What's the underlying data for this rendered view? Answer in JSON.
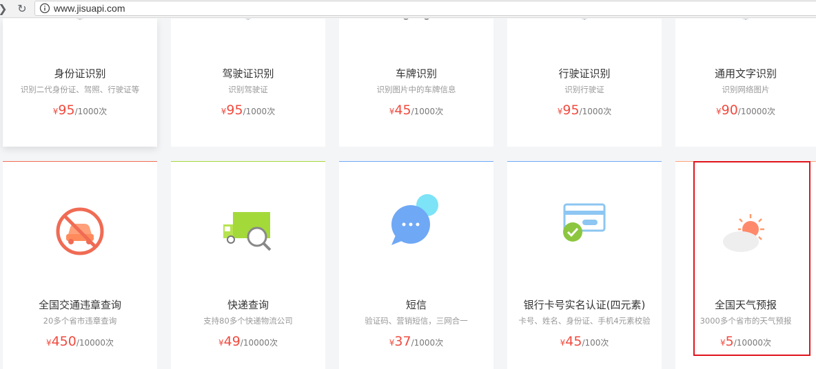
{
  "browser": {
    "url": "www.jisuapi.com"
  },
  "cards": [
    {
      "title": "身份证识别",
      "desc": "识别二代身份证、驾照、行驶证等",
      "currency": "¥",
      "price": "95",
      "unit": "/1000次",
      "icon": "id-card-scan-icon"
    },
    {
      "title": "驾驶证识别",
      "desc": "识别驾驶证",
      "currency": "¥",
      "price": "95",
      "unit": "/1000次",
      "icon": "driver-license-scan-icon"
    },
    {
      "title": "车牌识别",
      "desc": "识别图片中的车牌信息",
      "currency": "¥",
      "price": "45",
      "unit": "/1000次",
      "icon": "license-plate-car-icon"
    },
    {
      "title": "行驶证识别",
      "desc": "识别行驶证",
      "currency": "¥",
      "price": "95",
      "unit": "/1000次",
      "icon": "vehicle-license-scan-icon"
    },
    {
      "title": "通用文字识别",
      "desc": "识别网络图片",
      "currency": "¥",
      "price": "90",
      "unit": "/10000次",
      "icon": "text-ocr-scan-icon"
    },
    {
      "title": "全国交通违章查询",
      "desc": "20多个省市违章查询",
      "currency": "¥",
      "price": "450",
      "unit": "/10000次",
      "icon": "no-car-icon"
    },
    {
      "title": "快递查询",
      "desc": "支持80多个快递物流公司",
      "currency": "¥",
      "price": "49",
      "unit": "/10000次",
      "icon": "truck-search-icon"
    },
    {
      "title": "短信",
      "desc": "验证码、营销短信，三网合一",
      "currency": "¥",
      "price": "37",
      "unit": "/1000次",
      "icon": "chat-bubble-icon"
    },
    {
      "title": "银行卡号实名认证(四元素)",
      "desc": "卡号、姓名、身份证、手机4元素校验",
      "currency": "¥",
      "price": "45",
      "unit": "/100次",
      "icon": "bank-card-check-icon"
    },
    {
      "title": "全国天气预报",
      "desc": "3000多个省市的天气预报",
      "currency": "¥",
      "price": "5",
      "unit": "/10000次",
      "icon": "sun-cloud-icon"
    }
  ],
  "colors": {
    "price": "#f04b3f",
    "highlight_border": "#e0131b",
    "accent_traffic": "#f06b54",
    "accent_express": "#a4d93a",
    "accent_sms": "#6fa8f5",
    "accent_bank": "#8dc6f2",
    "accent_weather": "#ffa07a"
  }
}
